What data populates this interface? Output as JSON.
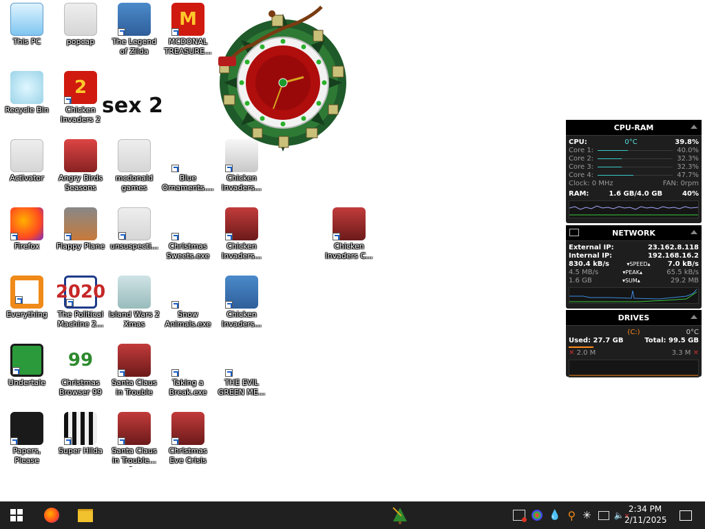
{
  "desktop": {
    "overlay_text": "sex 2",
    "icons": [
      {
        "label": "This PC"
      },
      {
        "label": "popcap"
      },
      {
        "label": "The Legend of Zilda"
      },
      {
        "label": "MCDONAL TREASURE..."
      },
      {
        "label": "Recycle Bin"
      },
      {
        "label": "Chicken Invaders 2"
      },
      {
        "label": "Activator"
      },
      {
        "label": "Angry Birds Seasons"
      },
      {
        "label": "mcdonald games"
      },
      {
        "label": "Blue Ornaments...."
      },
      {
        "label": "Chicken Invaders..."
      },
      {
        "label": "Firefox"
      },
      {
        "label": "Flappy Plane"
      },
      {
        "label": "unsuspecti..."
      },
      {
        "label": "Christmas Sweets.exe"
      },
      {
        "label": "Chicken Invaders..."
      },
      {
        "label": "Chicken Invaders C..."
      },
      {
        "label": "Everything"
      },
      {
        "label": "The Political Machine 2..."
      },
      {
        "label": "Island Wars 2 Xmas"
      },
      {
        "label": "Snow Animals.exe"
      },
      {
        "label": "Chicken Invaders..."
      },
      {
        "label": "Undertale"
      },
      {
        "label": "Christmas Browser 99"
      },
      {
        "label": "Santa Claus in Trouble"
      },
      {
        "label": "Taking a Break.exe"
      },
      {
        "label": "THE EVIL GREEN ME..."
      },
      {
        "label": "Papers, Please"
      },
      {
        "label": "Super Hilda"
      },
      {
        "label": "Santa Claus in Trouble... A..."
      },
      {
        "label": "Christmas Eve Crisis"
      }
    ],
    "icon_glyphs": {
      "mcdonalds": "M",
      "chicken2": "2",
      "political_year": "2020",
      "browser99": "99"
    }
  },
  "widgets": {
    "cpu_ram": {
      "title": "CPU-RAM",
      "cpu_label": "CPU:",
      "cpu_temp": "0°C",
      "cpu_percent": "39.8%",
      "cores": [
        {
          "label": "Core 1:",
          "value": "40.0%",
          "fraction": 0.4
        },
        {
          "label": "Core 2:",
          "value": "32.3%",
          "fraction": 0.323
        },
        {
          "label": "Core 3:",
          "value": "32.3%",
          "fraction": 0.323
        },
        {
          "label": "Core 4:",
          "value": "47.7%",
          "fraction": 0.477
        }
      ],
      "clock": "Clock: 0 MHz",
      "fan": "FAN: 0rpm",
      "ram_label": "RAM:",
      "ram_usage": "1.6 GB/4.0 GB",
      "ram_percent": "40%"
    },
    "network": {
      "title": "NETWORK",
      "external_label": "External IP:",
      "external_ip": "23.162.8.118",
      "internal_label": "Internal IP:",
      "internal_ip": "192.168.16.2",
      "speed_down": "830.4 kB/s",
      "speed_label": "SPEED",
      "speed_up": "7.0 kB/s",
      "peak_down": "4.5 MB/s",
      "peak_label": "PEAK",
      "peak_up": "65.5 kB/s",
      "sum_down": "1.6 GB",
      "sum_label": "SUM",
      "sum_up": "29.2 MB"
    },
    "drives": {
      "title": "DRIVES",
      "drive_letter": "(C:)",
      "temp": "0°C",
      "used": "Used: 27.7 GB",
      "total": "Total: 99.5 GB",
      "read": "2.0 M",
      "write": "3.3 M"
    }
  },
  "taskbar": {
    "time": "2:34 PM",
    "date": "2/11/2025"
  },
  "colors": {
    "taskbar_bg": "#202020",
    "widget_bg": "#1e1e1e",
    "accent_cyan": "#3cc9c9",
    "drive_orange": "#ff8c1a"
  }
}
